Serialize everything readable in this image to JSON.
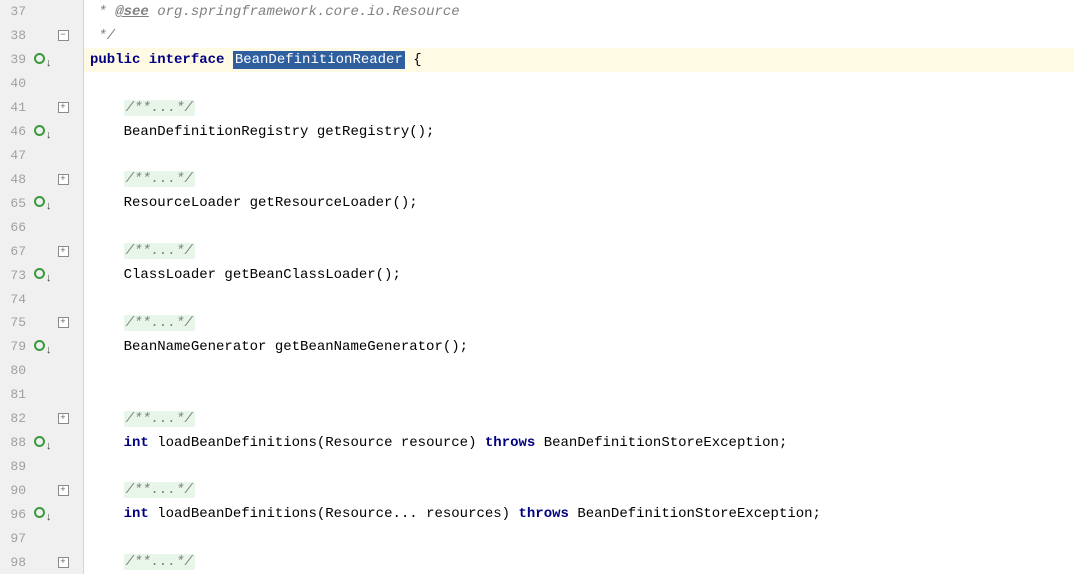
{
  "lines": [
    {
      "num": "37",
      "marker": false,
      "fold": null,
      "tokens": [
        {
          "cls": "cm",
          "t": " * "
        },
        {
          "cls": "doc-tag",
          "t": "@see"
        },
        {
          "cls": "cm",
          "t": " org.springframework.core.io.Resource"
        }
      ]
    },
    {
      "num": "38",
      "marker": false,
      "fold": "minus",
      "tokens": [
        {
          "cls": "cm",
          "t": " */"
        }
      ]
    },
    {
      "num": "39",
      "marker": true,
      "fold": null,
      "highlight": true,
      "tokens": [
        {
          "cls": "kw",
          "t": "public interface "
        },
        {
          "cls": "sel",
          "t": "BeanDefinitionReader"
        },
        {
          "cls": "",
          "t": " {"
        }
      ]
    },
    {
      "num": "40",
      "marker": false,
      "fold": null,
      "tokens": []
    },
    {
      "num": "41",
      "marker": false,
      "fold": "plus",
      "indent": 1,
      "tokens": [
        {
          "cls": "cm-fold",
          "t": "/**...*/"
        }
      ]
    },
    {
      "num": "46",
      "marker": true,
      "fold": null,
      "indent": 1,
      "tokens": [
        {
          "cls": "",
          "t": "BeanDefinitionRegistry getRegistry();"
        }
      ]
    },
    {
      "num": "47",
      "marker": false,
      "fold": null,
      "tokens": []
    },
    {
      "num": "48",
      "marker": false,
      "fold": "plus",
      "indent": 1,
      "tokens": [
        {
          "cls": "cm-fold",
          "t": "/**...*/"
        }
      ]
    },
    {
      "num": "65",
      "marker": true,
      "fold": null,
      "indent": 1,
      "tokens": [
        {
          "cls": "",
          "t": "ResourceLoader getResourceLoader();"
        }
      ]
    },
    {
      "num": "66",
      "marker": false,
      "fold": null,
      "tokens": []
    },
    {
      "num": "67",
      "marker": false,
      "fold": "plus",
      "indent": 1,
      "tokens": [
        {
          "cls": "cm-fold",
          "t": "/**...*/"
        }
      ]
    },
    {
      "num": "73",
      "marker": true,
      "fold": null,
      "indent": 1,
      "tokens": [
        {
          "cls": "",
          "t": "ClassLoader getBeanClassLoader();"
        }
      ]
    },
    {
      "num": "74",
      "marker": false,
      "fold": null,
      "tokens": []
    },
    {
      "num": "75",
      "marker": false,
      "fold": "plus",
      "indent": 1,
      "tokens": [
        {
          "cls": "cm-fold",
          "t": "/**...*/"
        }
      ]
    },
    {
      "num": "79",
      "marker": true,
      "fold": null,
      "indent": 1,
      "tokens": [
        {
          "cls": "",
          "t": "BeanNameGenerator getBeanNameGenerator();"
        }
      ]
    },
    {
      "num": "80",
      "marker": false,
      "fold": null,
      "tokens": []
    },
    {
      "num": "81",
      "marker": false,
      "fold": null,
      "tokens": []
    },
    {
      "num": "82",
      "marker": false,
      "fold": "plus",
      "indent": 1,
      "tokens": [
        {
          "cls": "cm-fold",
          "t": "/**...*/"
        }
      ]
    },
    {
      "num": "88",
      "marker": true,
      "fold": null,
      "indent": 1,
      "tokens": [
        {
          "cls": "kw",
          "t": "int"
        },
        {
          "cls": "",
          "t": " loadBeanDefinitions(Resource resource) "
        },
        {
          "cls": "kw",
          "t": "throws"
        },
        {
          "cls": "",
          "t": " BeanDefinitionStoreException;"
        }
      ]
    },
    {
      "num": "89",
      "marker": false,
      "fold": null,
      "tokens": []
    },
    {
      "num": "90",
      "marker": false,
      "fold": "plus",
      "indent": 1,
      "tokens": [
        {
          "cls": "cm-fold",
          "t": "/**...*/"
        }
      ]
    },
    {
      "num": "96",
      "marker": true,
      "fold": null,
      "indent": 1,
      "tokens": [
        {
          "cls": "kw",
          "t": "int"
        },
        {
          "cls": "",
          "t": " loadBeanDefinitions(Resource... resources) "
        },
        {
          "cls": "kw",
          "t": "throws"
        },
        {
          "cls": "",
          "t": " BeanDefinitionStoreException;"
        }
      ]
    },
    {
      "num": "97",
      "marker": false,
      "fold": null,
      "tokens": []
    },
    {
      "num": "98",
      "marker": false,
      "fold": "plus",
      "indent": 1,
      "tokens": [
        {
          "cls": "cm-fold",
          "t": "/**...*/"
        }
      ]
    }
  ],
  "fold_plus": "+",
  "fold_minus": "−"
}
